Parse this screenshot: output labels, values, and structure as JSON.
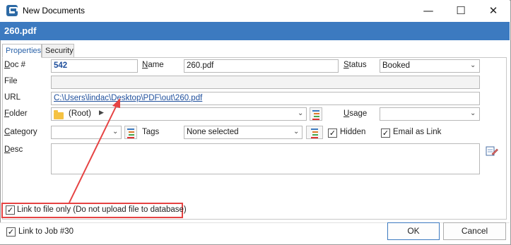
{
  "window": {
    "title": "New Documents",
    "minimize": "—",
    "maximize": "☐",
    "close": "✕"
  },
  "banner": {
    "filename": "260.pdf"
  },
  "tabs": [
    {
      "label": "Properties"
    },
    {
      "label": "Security"
    }
  ],
  "form": {
    "doc_label": "Doc #",
    "doc_value": "542",
    "name_label": "Name",
    "name_value": "260.pdf",
    "status_label": "Status",
    "status_value": "Booked",
    "file_label": "File",
    "file_value": "",
    "url_label": "URL",
    "url_value": "C:\\Users\\lindac\\Desktop\\PDF\\out\\260.pdf",
    "folder_label": "Folder",
    "folder_value": "(Root)",
    "usage_label": "Usage",
    "usage_value": "",
    "category_label": "Category",
    "category_value": "",
    "tags_label": "Tags",
    "tags_value": "None selected",
    "hidden_label": "Hidden",
    "hidden_checked": true,
    "email_label": "Email as Link",
    "email_checked": true,
    "desc_label": "Desc",
    "desc_value": ""
  },
  "link_only": {
    "label": "Link to file only (Do not upload file to database)",
    "checked": true
  },
  "link_job": {
    "label": "Link to Job #30",
    "checked": true
  },
  "buttons": {
    "ok": "OK",
    "cancel": "Cancel"
  },
  "colors": {
    "accent": "#3c7ac0",
    "annotation": "#e64343",
    "link": "#1f4f9c"
  },
  "icons": {
    "app": "app-icon",
    "folder": "folder-icon",
    "tree": "tree-list-icon",
    "edit": "edit-icon",
    "arrow": "annotation-arrow"
  }
}
